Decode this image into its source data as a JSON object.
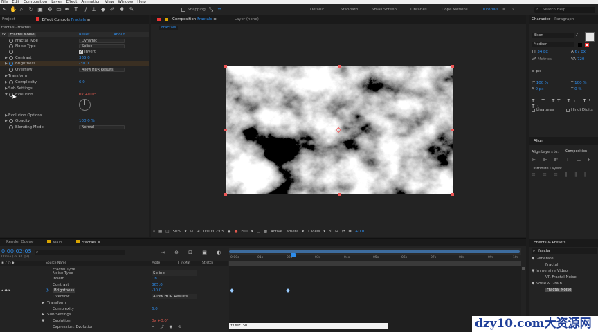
{
  "menu": [
    "File",
    "Edit",
    "Composition",
    "Layer",
    "Effect",
    "Animation",
    "View",
    "Window",
    "Help"
  ],
  "toolbar": {
    "snapping": "Snapping",
    "workspaces": [
      "Default",
      "Standard",
      "Small Screen",
      "Libraries",
      "Dope Motions",
      "Tutorials"
    ],
    "search_help": "Search Help"
  },
  "effects_panel": {
    "tab_project": "Project",
    "tab_effect": "Effect Controls",
    "tab_effect_target": "Fractals",
    "breadcrumb": "fractals · Fractals",
    "fx_badge": "fx",
    "effect_name": "Fractal Noise",
    "reset": "Reset",
    "about": "About...",
    "props": [
      {
        "label": "Fractal Type",
        "value": "Dynamic",
        "kind": "dropdown"
      },
      {
        "label": "Noise Type",
        "value": "Spline",
        "kind": "dropdown"
      },
      {
        "label": "",
        "value": "Invert",
        "kind": "checkbox"
      },
      {
        "label": "Contrast",
        "value": "365.0",
        "kind": "number"
      },
      {
        "label": "Brightness",
        "value": "-30.0",
        "kind": "number"
      },
      {
        "label": "Overflow",
        "value": "Allow HDR Results",
        "kind": "dropdown"
      },
      {
        "label": "Transform",
        "value": "",
        "kind": "group"
      },
      {
        "label": "Complexity",
        "value": "6.0",
        "kind": "number"
      },
      {
        "label": "Sub Settings",
        "value": "",
        "kind": "group"
      },
      {
        "label": "Evolution",
        "value": "0x +0.0°",
        "kind": "angle"
      },
      {
        "label": "Evolution Options",
        "value": "",
        "kind": "group"
      },
      {
        "label": "Opacity",
        "value": "100.0 %",
        "kind": "number"
      },
      {
        "label": "Blending Mode",
        "value": "Normal",
        "kind": "dropdown"
      }
    ]
  },
  "comp_panel": {
    "tab_label": "Composition",
    "tab_target": "Fractals",
    "layer_tab": "Layer  (none)",
    "sub_tab": "Fractals",
    "zoom": "50%",
    "timecode": "0:00:02:05",
    "resolution": "Full",
    "camera": "Active Camera",
    "views": "1 View",
    "exposure": "+0.0"
  },
  "right_panel": {
    "tab_character": "Character",
    "tab_paragraph": "Paragraph",
    "font": "Bison",
    "style": "Medium",
    "font_size": "34 px",
    "leading": "67 px",
    "tracking_label": "Metrics",
    "tracking": "720",
    "stroke": "px",
    "v_scale": "100 %",
    "h_scale": "100 %",
    "baseline": "0 px",
    "tsume": "0 %",
    "ligatures": "Ligatures",
    "hindi_digits": "Hindi Digits",
    "align_title": "Align",
    "align_to_label": "Align Layers to:",
    "align_to_value": "Composition",
    "distribute": "Distribute Layers:",
    "effects_tab": "Effects & Presets",
    "effects_search": "fracta",
    "tree": [
      {
        "label": "Generate",
        "level": 0
      },
      {
        "label": "Fractal",
        "level": 1
      },
      {
        "label": "Immersive Video",
        "level": 0
      },
      {
        "label": "VR Fractal Noise",
        "level": 1
      },
      {
        "label": "Noise & Grain",
        "level": 0
      },
      {
        "label": "Fractal Noise",
        "level": 1,
        "selected": true
      }
    ]
  },
  "timeline": {
    "tab_render": "Render Queue",
    "tab_main": "Main",
    "tab_fractals": "Fractals",
    "timecode": "0:00:02:05",
    "fps": "00065 (29.97 fps)",
    "columns": {
      "source": "Source Name",
      "mode": "Mode",
      "trkmat": "T  TrkMat",
      "stretch": "Stretch"
    },
    "rows": [
      {
        "label": "Fractal Type",
        "value": "Dynamic"
      },
      {
        "label": "Noise Type",
        "value": "Spline"
      },
      {
        "label": "Invert",
        "value": "On"
      },
      {
        "label": "Contrast",
        "value": "365.0"
      },
      {
        "label": "Brightness",
        "value": "-30.0"
      },
      {
        "label": "Overflow",
        "value": "Allow HDR Results"
      },
      {
        "label": "Transform",
        "value": ""
      },
      {
        "label": "Complexity",
        "value": "6.0"
      },
      {
        "label": "Sub Settings",
        "value": ""
      },
      {
        "label": "Evolution",
        "value": "0x +0.0°"
      },
      {
        "label": "Expression: Evolution",
        "value": ""
      }
    ],
    "ruler": [
      "0:00s",
      "01s",
      "02s",
      "03s",
      "04s",
      "05s",
      "06s",
      "07s",
      "08s",
      "09s",
      "10s"
    ],
    "expression": "time*150"
  },
  "watermark": "dzy10.com大资源网",
  "colors": {
    "accent": "#2d8ceb",
    "handle": "#e55555",
    "value_orange": "#d8822f"
  }
}
